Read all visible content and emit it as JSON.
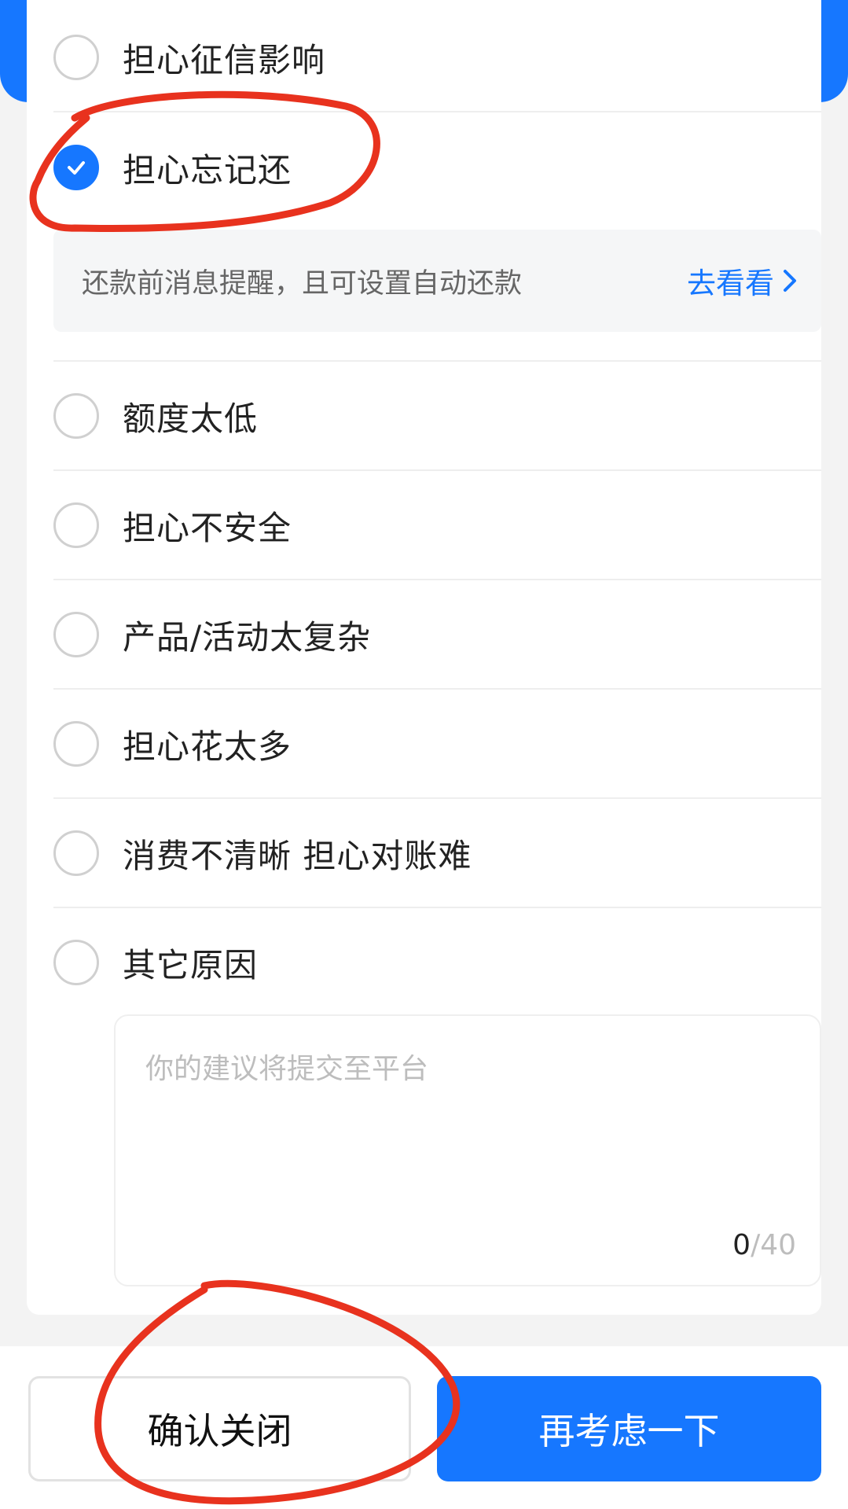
{
  "options": [
    {
      "label": "担心征信影响",
      "checked": false
    },
    {
      "label": "担心忘记还",
      "checked": true
    },
    {
      "label": "额度太低",
      "checked": false
    },
    {
      "label": "担心不安全",
      "checked": false
    },
    {
      "label": "产品/活动太复杂",
      "checked": false
    },
    {
      "label": "担心花太多",
      "checked": false
    },
    {
      "label": "消费不清晰 担心对账难",
      "checked": false
    },
    {
      "label": "其它原因",
      "checked": false
    }
  ],
  "tip": {
    "text": "还款前消息提醒，且可设置自动还款",
    "link_label": "去看看"
  },
  "feedback": {
    "placeholder": "你的建议将提交至平台",
    "count": "0",
    "max": "/40"
  },
  "buttons": {
    "confirm_close": "确认关闭",
    "reconsider": "再考虑一下"
  },
  "colors": {
    "accent": "#1677ff",
    "annotation": "#e8321e"
  }
}
